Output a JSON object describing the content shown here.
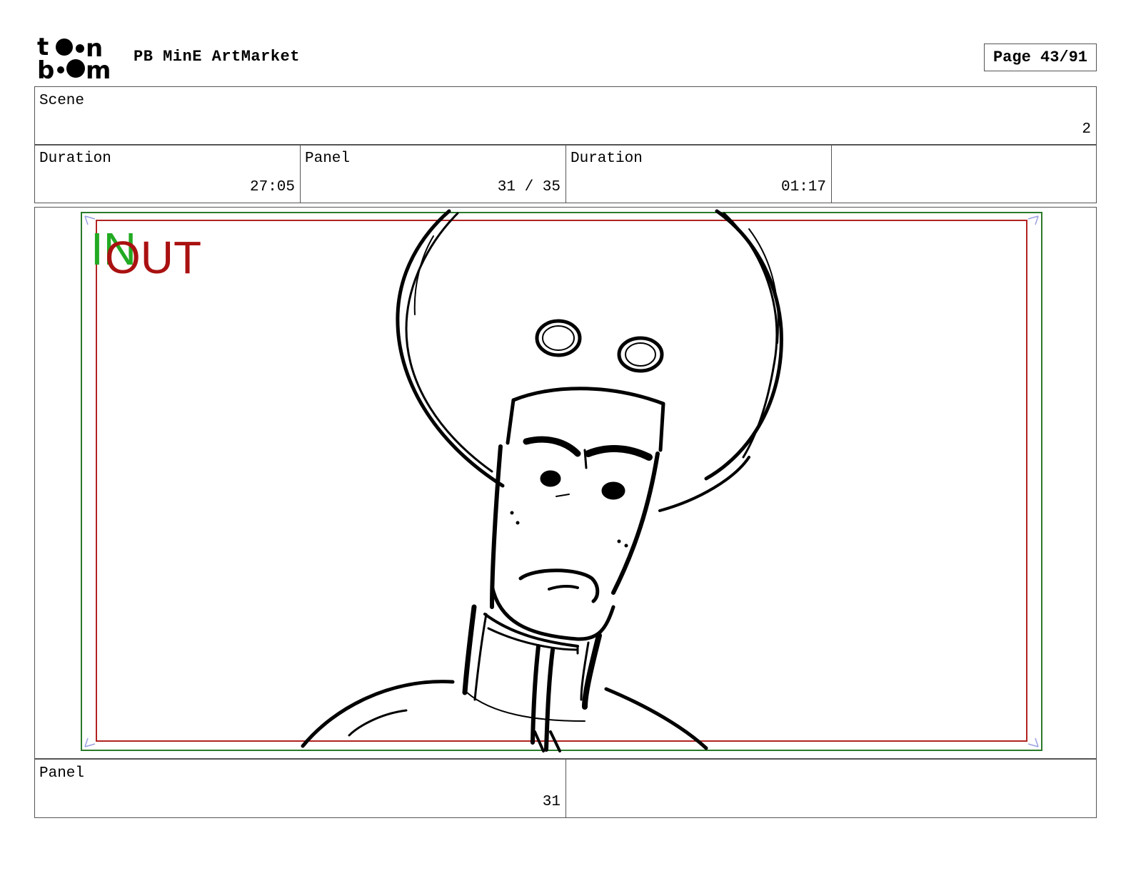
{
  "header": {
    "logo_text": "toon boom",
    "project_title": "PB MinE ArtMarket",
    "page_indicator": "Page 43/91"
  },
  "scene_row": {
    "label": "Scene",
    "value": "2"
  },
  "info_row": {
    "duration1_label": "Duration",
    "duration1_value": "27:05",
    "panel_label": "Panel",
    "panel_value": "31 / 35",
    "duration2_label": "Duration",
    "duration2_value": "01:17",
    "extra_value": ""
  },
  "frame": {
    "in_label": "IN",
    "out_label": "OUT",
    "in_color": "#22aa22",
    "out_color": "#aa1111",
    "safe_color": "#2a7a2a",
    "action_color": "#b22222"
  },
  "footer_row": {
    "panel_label": "Panel",
    "panel_value": "31",
    "notes": ""
  }
}
